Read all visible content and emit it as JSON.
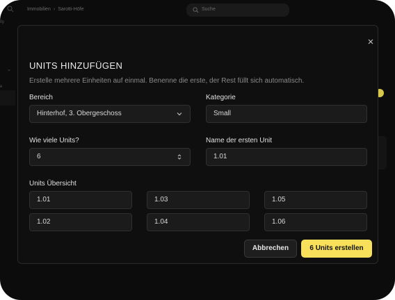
{
  "background": {
    "breadcrumb": [
      "Immobilien",
      "Sarotti-Höfe"
    ],
    "breadcrumb_sep": "›",
    "search_placeholder": "Suche",
    "side_fragments": [
      "ity",
      "e"
    ]
  },
  "modal": {
    "title": "UNITS HINZUFÜGEN",
    "subtitle": "Erstelle mehrere Einheiten auf einmal. Benenne die erste, der Rest füllt sich automatisch.",
    "bereich": {
      "label": "Bereich",
      "value": "Hinterhof, 3. Obergeschoss"
    },
    "kategorie": {
      "label": "Kategorie",
      "value": "Small"
    },
    "anzahl": {
      "label": "Wie viele Units?",
      "value": "6"
    },
    "erste_unit": {
      "label": "Name der ersten Unit",
      "value": "1.01"
    },
    "overview": {
      "label": "Units Übersicht",
      "units": [
        "1.01",
        "1.03",
        "1.05",
        "1.02",
        "1.04",
        "1.06"
      ]
    },
    "cancel_label": "Abbrechen",
    "create_label": "6 Units erstellen"
  },
  "colors": {
    "accent": "#f8e05a",
    "background": "#0c0c0c",
    "modal_bg": "#0f0f0f",
    "field_bg": "#1b1b1b"
  },
  "icons": {
    "close": "close-icon",
    "dropdown": "chevron-down-icon",
    "stepper": "chevron-up-down-icon",
    "search": "search-icon"
  }
}
